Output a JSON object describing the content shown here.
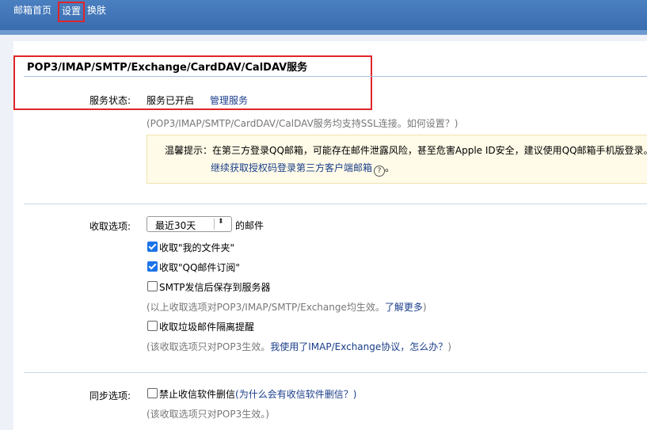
{
  "nav": {
    "home": "邮箱首页",
    "settings": "设置",
    "skin": "换肤"
  },
  "section": {
    "title": "POP3/IMAP/SMTP/Exchange/CardDAV/CalDAV服务"
  },
  "service": {
    "label": "服务状态:",
    "status": "服务已开启",
    "manage_link": "管理服务",
    "ssl_hint": "(POP3/IMAP/SMTP/CardDAV/CalDAV服务均支持SSL连接。如何设置？)"
  },
  "warning": {
    "line1": "温馨提示：在第三方登录QQ邮箱，可能存在邮件泄露风险，甚至危害Apple ID安全，建议使用QQ邮箱手机版登录。",
    "line2": "继续获取授权码登录第三方客户端邮箱",
    "help_glyph": "?"
  },
  "receive": {
    "label": "收取选项:",
    "range_selected": "最近30天",
    "range_suffix": "的邮件",
    "opt_my_folder": "收取\"我的文件夹\"",
    "opt_qq_sub": "收取\"QQ邮件订阅\"",
    "opt_smtp_save": "SMTP发信后保存到服务器",
    "hint1": "(以上收取选项对POP3/IMAP/SMTP/Exchange均生效。",
    "hint1_link": "了解更多",
    "hint1_end": ")",
    "opt_spam": "收取垃圾邮件隔离提醒",
    "hint2": "(该收取选项只对POP3生效。",
    "hint2_link": "我使用了IMAP/Exchange协议，怎么办？",
    "hint2_end": ")"
  },
  "sync": {
    "label": "同步选项:",
    "opt_no_delete": "禁止收信软件删信",
    "why_link": "(为什么会有收信软件删信？)",
    "hint": "(该收取选项只对POP3生效。)"
  },
  "checkbox_states": {
    "my_folder": true,
    "qq_sub": true,
    "smtp_save": false,
    "spam": false,
    "no_delete": false
  },
  "colors": {
    "topbar": "#3f74b6",
    "highlight": "#e0242a",
    "link": "#1a3e8a",
    "checkbox_checked": "#1a73e8"
  }
}
